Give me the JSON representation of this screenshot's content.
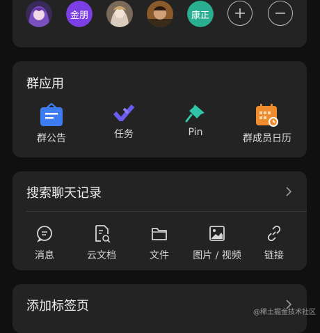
{
  "members": {
    "avatars": [
      {
        "type": "image",
        "desc": "anime-girl-avatar"
      },
      {
        "type": "text",
        "text": "金朋",
        "bg": "#7b3fe4"
      },
      {
        "type": "image",
        "desc": "doll-avatar"
      },
      {
        "type": "image",
        "desc": "man-avatar"
      },
      {
        "type": "text",
        "text": "康正",
        "bg": "#2aae92"
      }
    ],
    "add_icon": "plus-icon",
    "remove_icon": "minus-icon"
  },
  "group_apps": {
    "title": "群应用",
    "items": [
      {
        "label": "群公告",
        "icon": "announcement-icon",
        "color": "#3e7cf1"
      },
      {
        "label": "任务",
        "icon": "task-check-icon",
        "color": "#6b5cf0"
      },
      {
        "label": "Pin",
        "icon": "pin-icon",
        "color": "#30c4a8"
      },
      {
        "label": "群成员日历",
        "icon": "calendar-icon",
        "color": "#f08c2e"
      }
    ]
  },
  "search": {
    "title": "搜索聊天记录",
    "tools": [
      {
        "label": "消息",
        "icon": "message-icon"
      },
      {
        "label": "云文档",
        "icon": "cloud-doc-icon"
      },
      {
        "label": "文件",
        "icon": "folder-icon"
      },
      {
        "label": "图片 / 视频",
        "icon": "image-icon"
      },
      {
        "label": "链接",
        "icon": "link-icon"
      }
    ]
  },
  "tag": {
    "title": "添加标签页"
  },
  "watermark": "@稀土掘金技术社区"
}
